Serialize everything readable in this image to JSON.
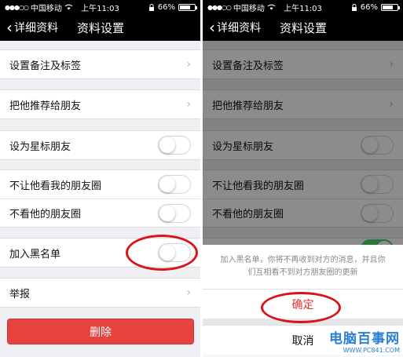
{
  "left": {
    "status": {
      "carrier": "中国移动",
      "time": "上午11:03",
      "battery": "66%"
    },
    "nav": {
      "back_label": "详细资料",
      "title": "资料设置"
    },
    "rows": {
      "remark": "设置备注及标签",
      "recommend": "把他推荐给朋友",
      "star": "设为星标朋友",
      "hide_my_moments": "不让他看我的朋友圈",
      "hide_his_moments": "不看他的朋友圈",
      "blacklist": "加入黑名单",
      "report": "举报"
    },
    "delete_label": "删除"
  },
  "right": {
    "status": {
      "carrier": "中国移动",
      "time": "上午11:03",
      "battery": "66%"
    },
    "nav": {
      "back_label": "详细资料",
      "title": "资料设置"
    },
    "rows": {
      "remark": "设置备注及标签",
      "recommend": "把他推荐给朋友",
      "star": "设为星标朋友",
      "hide_my_moments": "不让他看我的朋友圈",
      "hide_his_moments": "不看他的朋友圈"
    },
    "sheet": {
      "message": "加入黑名单，你将不再收到对方的消息，并且你们互相看不到对方朋友圈的更新",
      "confirm_label": "确定",
      "cancel_label": "取消"
    }
  },
  "watermark": {
    "text": "电脑百事网",
    "url": "WWW.PC841.COM"
  },
  "colors": {
    "delete_red": "#e64340",
    "annotation_red": "#d8141c",
    "switch_on": "#4cd964",
    "watermark_blue": "#2a7fd4"
  },
  "icons": [
    "back-chevron-icon",
    "wifi-icon",
    "lock-icon",
    "battery-icon",
    "chevron-right-icon"
  ]
}
